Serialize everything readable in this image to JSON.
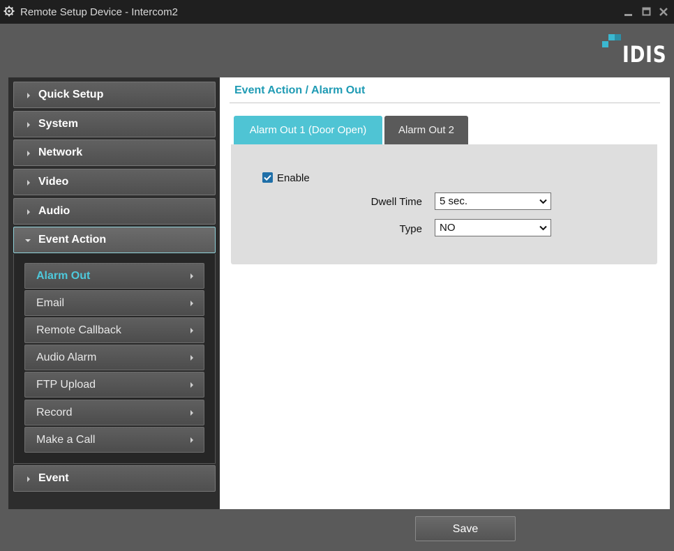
{
  "window": {
    "title": "Remote Setup Device - Intercom2",
    "icon": "gear-icon",
    "controls": [
      "minimize-icon",
      "maximize-icon",
      "close-icon"
    ]
  },
  "logo": {
    "text": "IDIS"
  },
  "sidebar": {
    "items": [
      {
        "label": "Quick Setup",
        "expanded": false
      },
      {
        "label": "System",
        "expanded": false
      },
      {
        "label": "Network",
        "expanded": false
      },
      {
        "label": "Video",
        "expanded": false
      },
      {
        "label": "Audio",
        "expanded": false
      },
      {
        "label": "Event Action",
        "expanded": true
      },
      {
        "label": "Event",
        "expanded": false
      }
    ],
    "submenu": [
      {
        "label": "Alarm Out",
        "selected": true
      },
      {
        "label": "Email",
        "selected": false
      },
      {
        "label": "Remote Callback",
        "selected": false
      },
      {
        "label": "Audio Alarm",
        "selected": false
      },
      {
        "label": "FTP Upload",
        "selected": false
      },
      {
        "label": "Record",
        "selected": false
      },
      {
        "label": "Make a Call",
        "selected": false
      }
    ]
  },
  "main": {
    "title": "Event Action / Alarm Out",
    "tabs": [
      {
        "label": "Alarm Out 1 (Door Open)",
        "active": true
      },
      {
        "label": "Alarm Out 2",
        "active": false
      }
    ],
    "enable": {
      "label": "Enable",
      "checked": true
    },
    "dwell_time": {
      "label": "Dwell Time",
      "value": "5 sec."
    },
    "type": {
      "label": "Type",
      "value": "NO"
    }
  },
  "footer": {
    "save_label": "Save"
  },
  "colors": {
    "accent": "#4fc4d4",
    "title_text": "#1f9bb4",
    "selected_text": "#4ec9dc",
    "logo_mark": "#3bb8d0"
  }
}
